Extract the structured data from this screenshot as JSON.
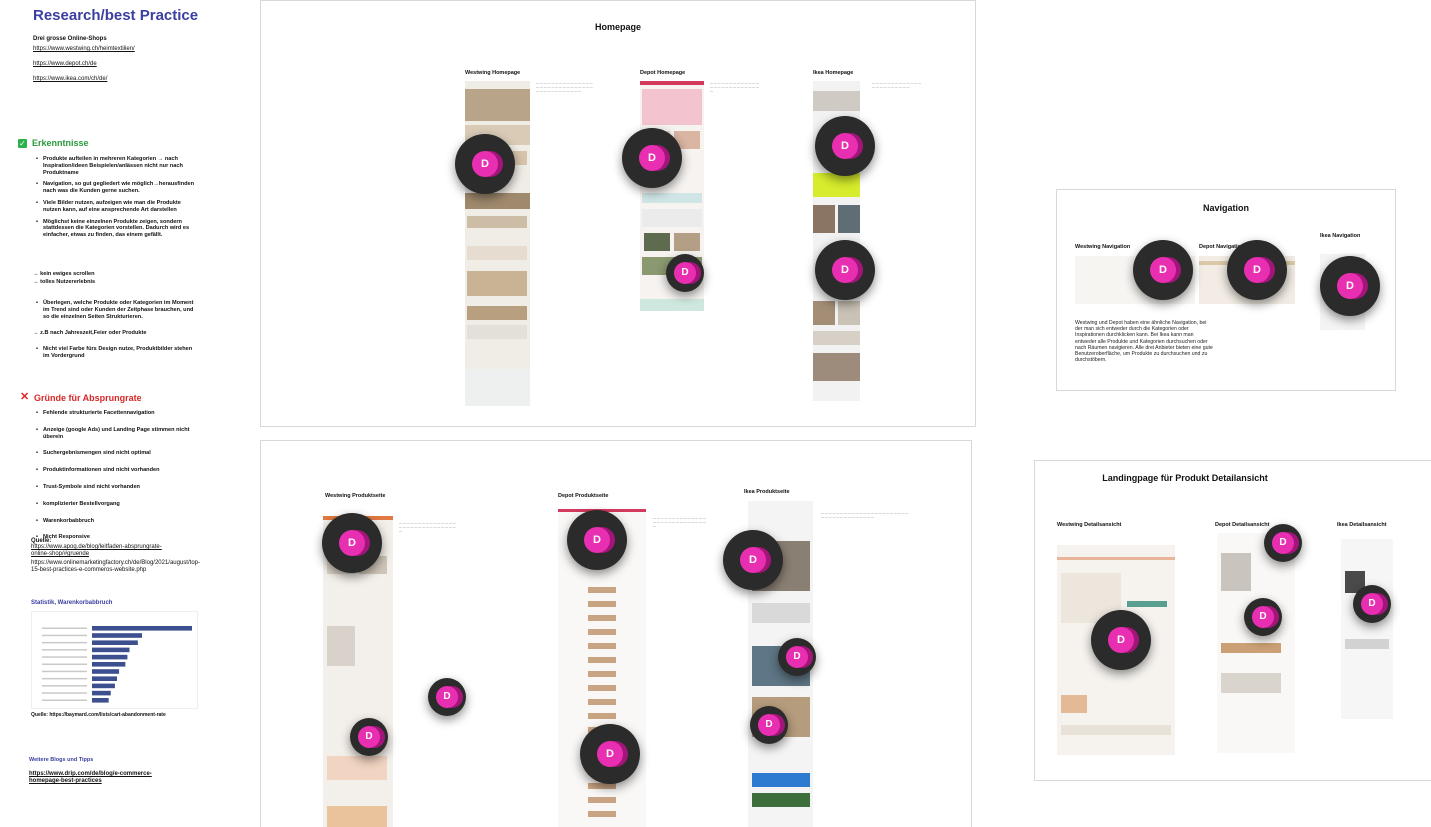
{
  "research": {
    "title": "Research/best Practice",
    "shops_heading": "Drei grosse Online-Shops",
    "links": [
      "https://www.westwing.ch/heimtextilien/",
      "https://www.depot.ch/de",
      "https://www.ikea.com/ch/de/"
    ]
  },
  "insights": {
    "icon": "check-icon",
    "icon_color": "#2bb24c",
    "title": "Erkenntnisse",
    "title_color": "#2a9a3c",
    "items": [
      "Produkte aufteilen in mehreren Kategorien → nach Inspiration/ideen Beispielen/anlässen nicht nur nach Produktname",
      "Navigation, so gut gegliedert wie möglich→herausfinden nach was die Kunden gerne suchen.",
      "Viele Bilder nutzen, aufzeigen wie man die Produkte nutzen kann, auf eine ansprechende Art darstellen",
      "Möglichst keine einzelnen Produkte zeigen, sondern stattdessen die Kategorien vorstellen. Dadurch wird es einfacher, etwas zu finden, das einem gefällt."
    ],
    "arrows_1": [
      "→ kein ewiges scrollen",
      "→ tolles Nutzererlebnis"
    ],
    "item_trend": "Überlegen, welche Produkte oder Kategorien im Moment im Trend sind oder Kunden der Zeitphase brauchen, und so die einzelnen Seiten Strukturieren.",
    "arrow_2": "→ z.B nach Jahreszeit,Feier oder Produkte",
    "item_color": "Nicht viel Farbe fürs Design nutze, Produktbilder stehen im Vordergrund"
  },
  "bounce": {
    "icon": "cross-icon",
    "icon_color": "#e02424",
    "title": "Gründe für Absprungrate",
    "title_color": "#d62828",
    "items": [
      "Fehlende strukturierte Facettennavigation",
      "Anzeige (google Ads) und Landing Page stimmen nicht überein",
      "Suchergebnismengen sind nicht optimal",
      "Produktinformationen sind nicht vorhanden",
      "Trust-Symbole sind nicht vorhanden",
      "komplizierter Bestellvorgang",
      "Warenkorbabbruch",
      "Nicht Responsive"
    ],
    "sources_label": "Quelle:",
    "source_1": "https://www.apog.de/blog/leitfaden-absprungrate-online-shop/#gruende",
    "source_2": "https://www.onlinemarketingfactory.ch/de/Blog/2021/august/top-15-best-practices-e-commeros-website.php"
  },
  "stats": {
    "title": "Statistik, Warenkorbabbruch",
    "source": "Quelle: https://baymard.com/lists/cart-abandonment-rate"
  },
  "chart_data": {
    "type": "bar",
    "values": [
      48,
      24,
      22,
      18,
      17,
      16,
      13,
      12,
      11,
      9,
      8
    ]
  },
  "blogs": {
    "title": "Weitere Blogs und Tipps",
    "link": "https://www.drip.com/de/blog/e-commerce-homepage-best-practices"
  },
  "homepage": {
    "title": "Homepage",
    "cols": [
      "Westwing Homepage",
      "Depot Homepage",
      "Ikea Homepage"
    ]
  },
  "produkt": {
    "cols": [
      "Westwing Produktseite",
      "Depot Produktseite",
      "Ikea Produktseite"
    ]
  },
  "navigation": {
    "title": "Navigation",
    "cols": [
      "Westwing Navigation",
      "Depot Navigation",
      "Ikea Navigation"
    ],
    "text": "Westwing und Depot haben eine ähnliche Navigation, bei der man sich entweder durch die Kategorien oder Inspirationen durchklicken kann. Bei Ikea kann man entweder alle Produkte und Kategorien durchsuchen oder nach Räumen navigieren. Alle drei Anbieter bieten eine gute Benutzeroberfläche, um Produkte zu durchsuchen und zu durchstöbern."
  },
  "landing": {
    "title": "Landingpage für Produkt Detailansicht",
    "cols": [
      "Westwing Detailsansicht",
      "Depot Detailsansicht",
      "Ikea Detailsansicht"
    ]
  },
  "avatar_letter": "D",
  "colors": {
    "avatar": "#e92fb1",
    "avatar_shadow": "#a3157a",
    "marker_bg": "#2b2b2b",
    "depot_accent": "#d33a5d",
    "title_blue": "#3a3fa0"
  }
}
